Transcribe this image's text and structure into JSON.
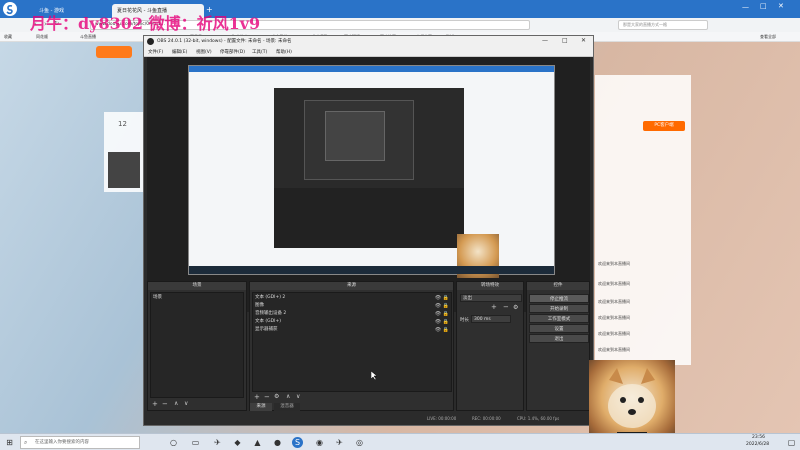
{
  "browser": {
    "tabs": [
      {
        "label": "斗鱼 - 游戏"
      },
      {
        "label": "夏日花花风 - 斗鱼直播"
      }
    ],
    "address": "www.douyu.com/topic/0-yn-1...",
    "search_placeholder": "那是大家的直播方式一格",
    "bookmarks": [
      "收藏",
      "同花顺",
      "斗鱼直播",
      "网易云",
      "淘宝特卖",
      "京东购物",
      "苏宁易购",
      "百度翻译",
      "百度地图",
      "去哪儿网",
      "微博",
      "查看全部"
    ]
  },
  "watermark": "月牛：dy8302  微博：祈风1v9",
  "site": {
    "left_panel_count": "12",
    "right_panel": {
      "badge": "PC客户端",
      "chat": [
        "欢迎来到本直播间",
        "欢迎来到本直播间",
        "欢迎来到本直播间",
        "欢迎来到本直播间",
        "欢迎来到本直播间",
        "欢迎来到本直播间"
      ]
    }
  },
  "obs": {
    "title": "OBS 24.0.1 (32-bit, windows) - 配置文件: 未命名 - 场景: 未命名",
    "menu": [
      "文件(F)",
      "编辑(E)",
      "视图(V)",
      "停靠部件(D)",
      "工具(T)",
      "帮助(H)"
    ],
    "docks": {
      "scenes": {
        "title": "场景",
        "items": [
          "场景"
        ]
      },
      "sources": {
        "title": "来源",
        "items": [
          "文本 (GDI+) 2",
          "图像",
          "音频输出设备 2",
          "文本 (GDI+)",
          "显示器捕获"
        ],
        "tabs": [
          "来源",
          "混音器"
        ]
      },
      "transitions": {
        "title": "转场特效",
        "type": "淡出",
        "duration_label": "时长",
        "duration_value": "300 ms"
      },
      "controls": {
        "title": "控件",
        "buttons": [
          "停止推流",
          "开始录制",
          "工作室模式",
          "设置",
          "退出"
        ]
      }
    },
    "status": {
      "live": "LIVE: 00:00:00",
      "rec": "REC: 00:00:00",
      "cpu": "CPU: 1.4%, 60.00 fps"
    }
  },
  "taskbar": {
    "search_placeholder": "在这里输入你要搜索的内容",
    "time": "23:56",
    "date": "2022/6/28"
  }
}
